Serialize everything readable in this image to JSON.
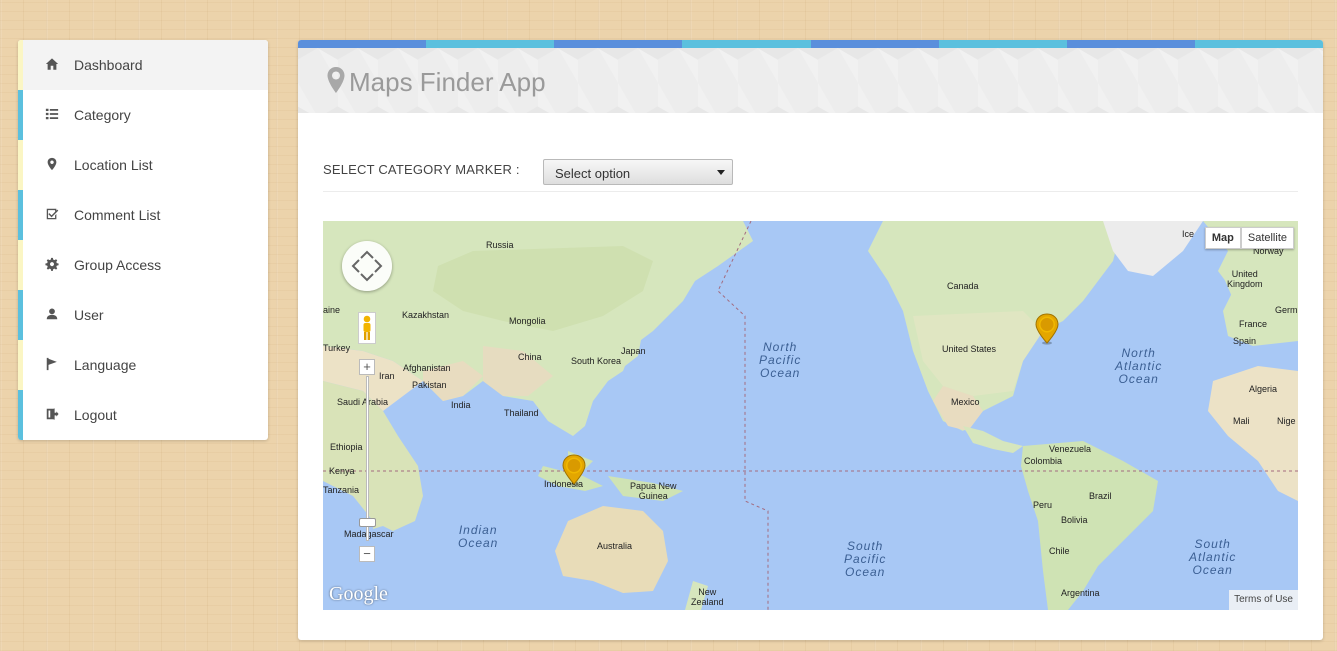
{
  "sidebar": {
    "items": [
      {
        "label": "Dashboard",
        "icon": "home-icon"
      },
      {
        "label": "Category",
        "icon": "list-icon"
      },
      {
        "label": "Location List",
        "icon": "map-marker-icon"
      },
      {
        "label": "Comment List",
        "icon": "checkbox-icon"
      },
      {
        "label": "Group Access",
        "icon": "gear-icon"
      },
      {
        "label": "User",
        "icon": "user-icon"
      },
      {
        "label": "Language",
        "icon": "flag-icon"
      },
      {
        "label": "Logout",
        "icon": "logout-icon"
      }
    ],
    "active_index": 0,
    "stripe_colors": [
      "#fbf6c4",
      "#5bc0de"
    ]
  },
  "header": {
    "title": "Maps Finder App",
    "icon": "map-marker-icon",
    "color_bar": [
      "#5a8fdc",
      "#5bc0de"
    ]
  },
  "filter": {
    "label": "SELECT CATEGORY MARKER :",
    "select_value": "Select option"
  },
  "map": {
    "type_buttons": {
      "map": "Map",
      "satellite": "Satellite"
    },
    "terms": "Terms of Use",
    "logo": "Google",
    "ice_label": "Ice",
    "zoom_in": "+",
    "zoom_out": "−",
    "labels": {
      "russia": "Russia",
      "kazakhstan": "Kazakhstan",
      "mongolia": "Mongolia",
      "china": "China",
      "south_korea": "South Korea",
      "japan": "Japan",
      "turkey": "Turkey",
      "afghanistan": "Afghanistan",
      "iran": "Iran",
      "pakistan": "Pakistan",
      "saudi_arabia": "Saudi Arabia",
      "india": "India",
      "thailand": "Thailand",
      "ethiopia": "Ethiopia",
      "kenya": "Kenya",
      "tanzania": "Tanzania",
      "madagascar": "Madagascar",
      "indonesia": "Indonesia",
      "papua_new_guinea": "Papua New\nGuinea",
      "australia": "Australia",
      "new_zealand": "New\nZealand",
      "canada": "Canada",
      "united_states": "United States",
      "mexico": "Mexico",
      "venezuela": "Venezuela",
      "colombia": "Colombia",
      "peru": "Peru",
      "brazil": "Brazil",
      "bolivia": "Bolivia",
      "chile": "Chile",
      "argentina": "Argentina",
      "united_kingdom": "United\nKingdom",
      "norway": "Norway",
      "germany": "Germ",
      "france": "France",
      "spain": "Spain",
      "algeria": "Algeria",
      "mali": "Mali",
      "niger": "Nige",
      "ukraine": "aine"
    },
    "oceans": {
      "north_pacific": "North\nPacific\nOcean",
      "south_pacific": "South\nPacific\nOcean",
      "north_atlantic": "North\nAtlantic\nOcean",
      "south_atlantic": "South\nAtlantic\nOcean",
      "indian": "Indian\nOcean"
    },
    "markers": [
      {
        "name": "marker-indonesia",
        "near": "Indonesia"
      },
      {
        "name": "marker-united-states",
        "near": "United States"
      }
    ]
  }
}
